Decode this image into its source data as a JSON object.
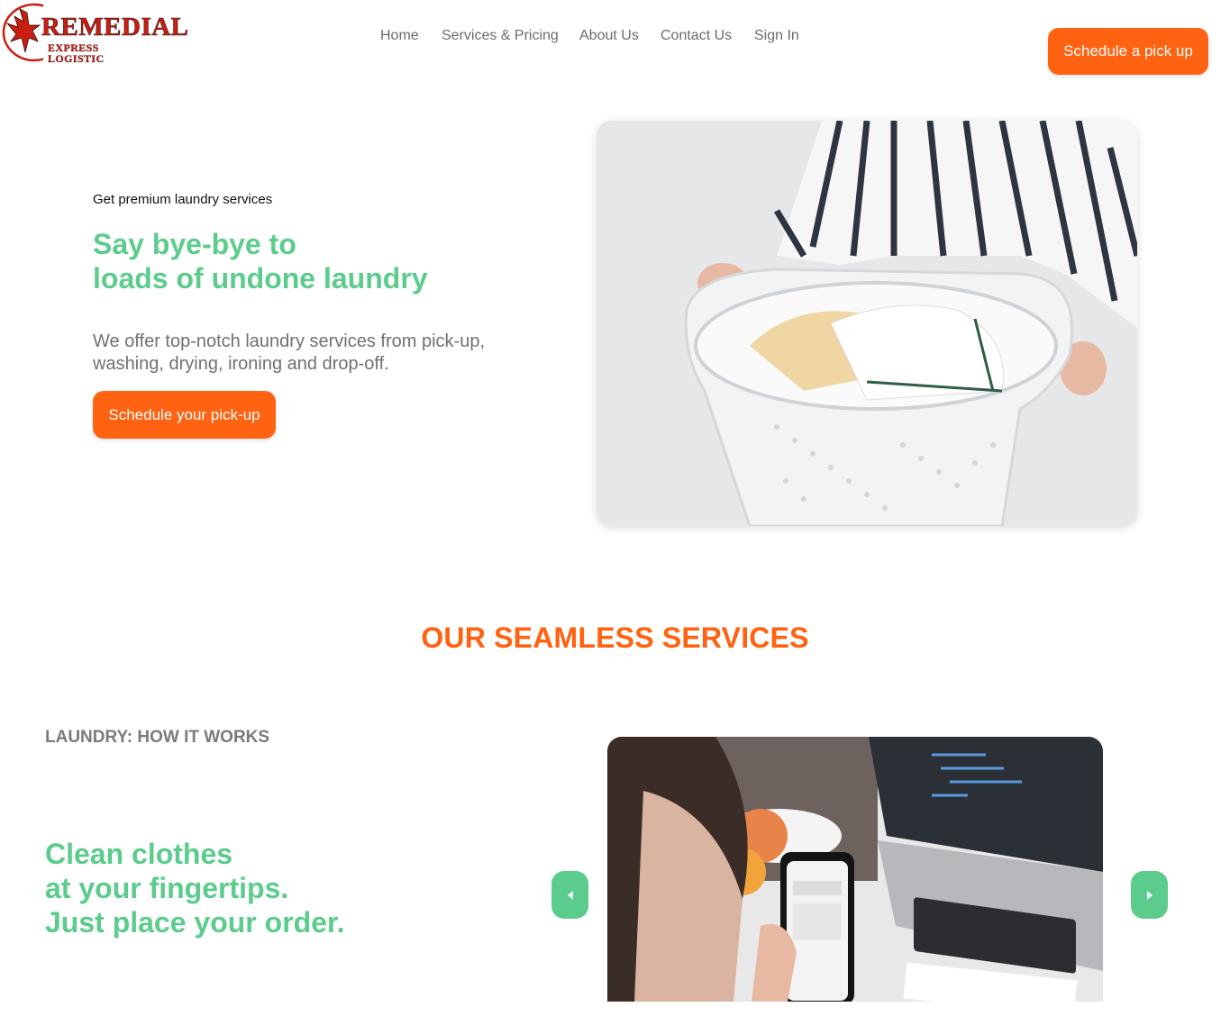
{
  "brand": {
    "name": "REMEDIAL",
    "tagline": "EXPRESS LOGISTIC",
    "colors": {
      "primary": "#ff6210",
      "accent": "#5ccc8c",
      "logo_red": "#c81f12"
    }
  },
  "nav": {
    "items": [
      {
        "label": "Home"
      },
      {
        "label": "Services & Pricing"
      },
      {
        "label": "About Us"
      },
      {
        "label": "Contact Us"
      },
      {
        "label": "Sign In"
      }
    ],
    "cta_label": "Schedule a pick up"
  },
  "hero": {
    "eyebrow": "Get premium laundry services",
    "title_lines": [
      "Say bye-bye to",
      "loads of undone laundry"
    ],
    "description": "We offer top-notch laundry services from pick-up, washing, drying, ironing and drop-off.",
    "cta_label": "Schedule your pick-up",
    "image_icon": "laundry-basket-photo"
  },
  "services": {
    "title": "OUR SEAMLESS SERVICES",
    "slide": {
      "label": "LAUNDRY: HOW IT WORKS",
      "title_lines": [
        "Clean clothes",
        "at your fingertips.",
        "Just place your order."
      ],
      "image_icon": "phone-order-photo"
    },
    "prev_icon": "caret-left-icon",
    "next_icon": "caret-right-icon"
  }
}
